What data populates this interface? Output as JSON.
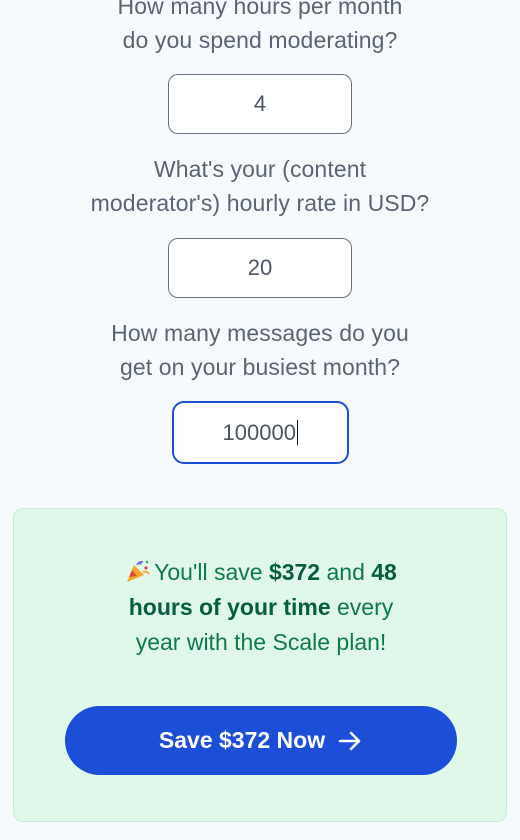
{
  "questions": {
    "hours": {
      "line1": "How many hours per month",
      "line2": "do you spend moderating?",
      "value": "4"
    },
    "rate": {
      "line1": "What's your (content",
      "line2": "moderator's) hourly rate in USD?",
      "value": "20"
    },
    "messages": {
      "line1": "How many messages do you",
      "line2": "get on your busiest month?",
      "value": "100000"
    }
  },
  "result": {
    "icon": "party-popper-icon",
    "prefix": "You'll save ",
    "amount": "$372",
    "middle": " and ",
    "hours": "48",
    "hours_suffix": "hours of your time",
    "suffix": " every year with the Scale plan!"
  },
  "cta": {
    "label": "Save $372 Now",
    "icon": "arrow-right-icon"
  },
  "colors": {
    "accent": "#1d4ed8",
    "success_bg": "#dff8e9",
    "success_text": "#0e7a4a"
  }
}
